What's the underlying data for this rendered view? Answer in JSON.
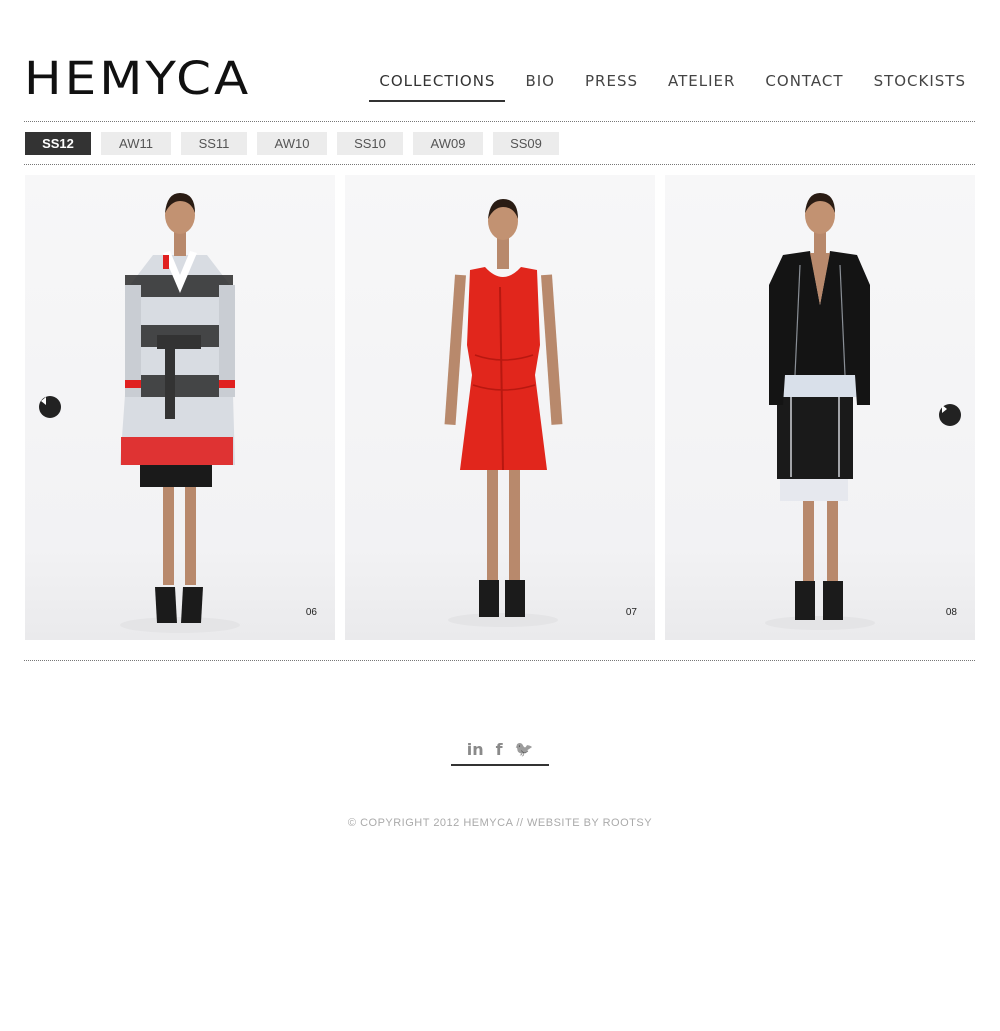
{
  "brand": {
    "logo_text": "HEMYCA"
  },
  "nav": {
    "items": [
      "COLLECTIONS",
      "BIO",
      "PRESS",
      "ATELIER",
      "CONTACT",
      "STOCKISTS"
    ],
    "active": "COLLECTIONS"
  },
  "seasons": {
    "items": [
      "SS12",
      "AW11",
      "SS11",
      "AW10",
      "SS10",
      "AW09",
      "SS09"
    ],
    "active": "SS12"
  },
  "gallery": {
    "photos": [
      {
        "number": "06",
        "garment": "striped-sheer-coat"
      },
      {
        "number": "07",
        "garment": "red-dress"
      },
      {
        "number": "08",
        "garment": "black-jacket-skirt"
      }
    ],
    "prev_icon": "arrow-left-icon",
    "next_icon": "arrow-right-icon"
  },
  "social": {
    "icons": [
      {
        "name": "linkedin-icon",
        "glyph": "in"
      },
      {
        "name": "facebook-icon",
        "glyph": "f"
      },
      {
        "name": "twitter-icon",
        "glyph": "🐦"
      }
    ]
  },
  "footer": {
    "copyright": "© COPYRIGHT 2012 HEMYCA // WEBSITE BY ROOTSY"
  },
  "colors": {
    "text": "#333333",
    "active_tab_bg": "#333333",
    "tab_bg": "#ececec",
    "accent_red": "#e02020"
  }
}
